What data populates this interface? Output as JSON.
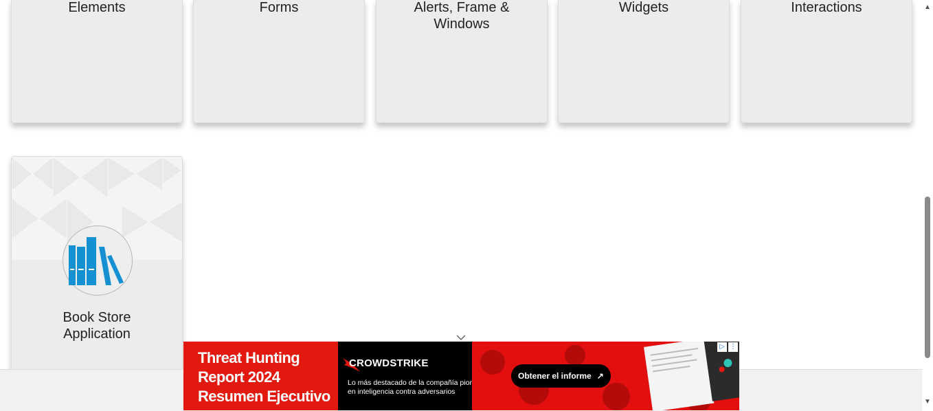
{
  "cards": [
    {
      "id": "elements",
      "title": "Elements"
    },
    {
      "id": "forms",
      "title": "Forms"
    },
    {
      "id": "alerts",
      "title": "Alerts, Frame &\nWindows"
    },
    {
      "id": "widgets",
      "title": "Widgets"
    },
    {
      "id": "interactions",
      "title": "Interactions"
    },
    {
      "id": "bookstore",
      "title": "Book Store\nApplication",
      "icon": "book-store-icon"
    }
  ],
  "ad": {
    "headline": "Threat Hunting\nReport 2024\nResumen Ejecutivo",
    "brand": "CROWDSTRIKE",
    "description": "Lo más destacado de la compañía pionera en inteligencia contra adversarios",
    "cta": "Obtener el informe",
    "cta_arrow": "↗",
    "colors": {
      "red": "#e1190f",
      "black": "#000000"
    }
  },
  "colors": {
    "card_bg": "#ececec",
    "icon_blue": "#1591d3"
  }
}
